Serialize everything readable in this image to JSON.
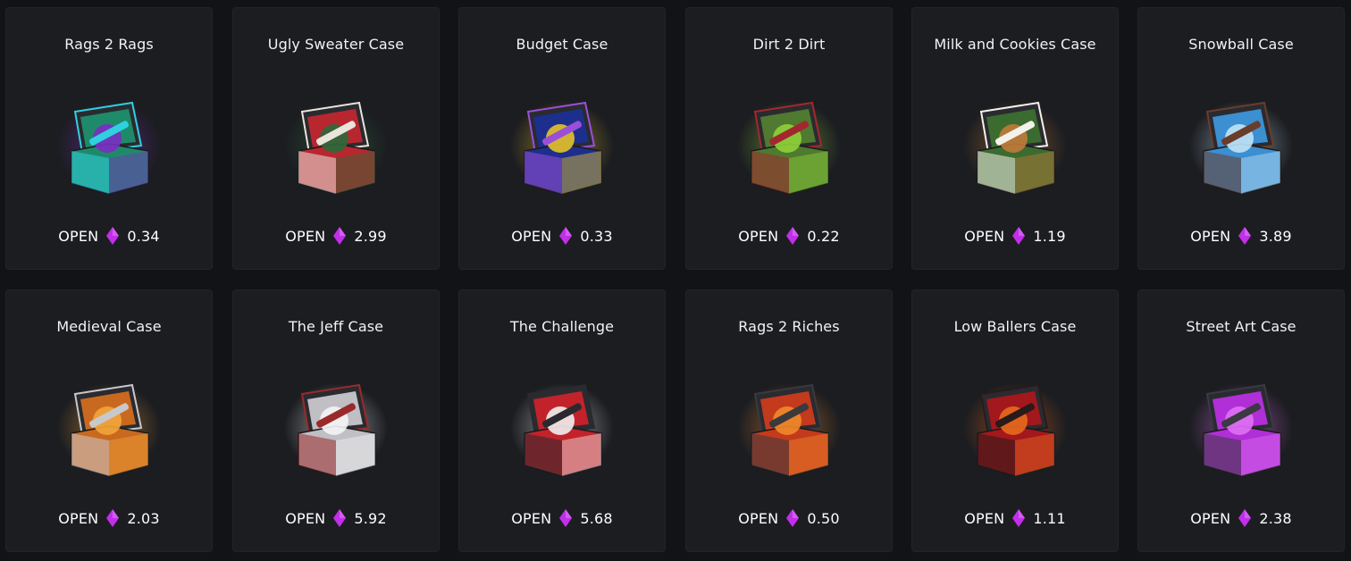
{
  "cases": [
    {
      "name": "Rags 2 Rags",
      "open_label": "OPEN",
      "price": "0.34",
      "icon": "rags-2-rags-case-icon",
      "colors": [
        "#1f8a6a",
        "#7b2cc4",
        "#2fd0e0"
      ]
    },
    {
      "name": "Ugly Sweater Case",
      "open_label": "OPEN",
      "price": "2.99",
      "icon": "ugly-sweater-case-icon",
      "colors": [
        "#b8272f",
        "#2b6a3a",
        "#e9e4dc"
      ]
    },
    {
      "name": "Budget Case",
      "open_label": "OPEN",
      "price": "0.33",
      "icon": "budget-case-icon",
      "colors": [
        "#1d2f8c",
        "#e7c32a",
        "#9b4fd8"
      ]
    },
    {
      "name": "Dirt 2 Dirt",
      "open_label": "OPEN",
      "price": "0.22",
      "icon": "dirt-2-dirt-case-icon",
      "colors": [
        "#4f7a2f",
        "#8fd23a",
        "#a3282e"
      ]
    },
    {
      "name": "Milk and Cookies Case",
      "open_label": "OPEN",
      "price": "1.19",
      "icon": "milk-and-cookies-case-icon",
      "colors": [
        "#3b6b2f",
        "#c27a3a",
        "#f4f1ea"
      ]
    },
    {
      "name": "Snowball Case",
      "open_label": "OPEN",
      "price": "3.89",
      "icon": "snowball-case-icon",
      "colors": [
        "#3c8fd0",
        "#bfe3f6",
        "#6a3d2a"
      ]
    },
    {
      "name": "Medieval Case",
      "open_label": "OPEN",
      "price": "2.03",
      "icon": "medieval-case-icon",
      "colors": [
        "#c9691f",
        "#f2a53a",
        "#c8c8cc"
      ]
    },
    {
      "name": "The Jeff Case",
      "open_label": "OPEN",
      "price": "5.92",
      "icon": "jeff-case-icon",
      "colors": [
        "#bfbfc4",
        "#f4f4f6",
        "#9a2a2a"
      ]
    },
    {
      "name": "The Challenge",
      "open_label": "OPEN",
      "price": "5.68",
      "icon": "challenge-case-icon",
      "colors": [
        "#c2232a",
        "#f0f0f0",
        "#2a2a2e"
      ]
    },
    {
      "name": "Rags 2 Riches",
      "open_label": "OPEN",
      "price": "0.50",
      "icon": "rags-2-riches-case-icon",
      "colors": [
        "#c43a1c",
        "#f08a2a",
        "#3a3a3e"
      ]
    },
    {
      "name": "Low Ballers Case",
      "open_label": "OPEN",
      "price": "1.11",
      "icon": "low-ballers-case-icon",
      "colors": [
        "#a3181c",
        "#e86a1e",
        "#2a1a1a"
      ]
    },
    {
      "name": "Street Art Case",
      "open_label": "OPEN",
      "price": "2.38",
      "icon": "street-art-case-icon",
      "colors": [
        "#b02fd6",
        "#e070f5",
        "#3a3a40"
      ]
    }
  ],
  "gem_color": "#c12fe8"
}
